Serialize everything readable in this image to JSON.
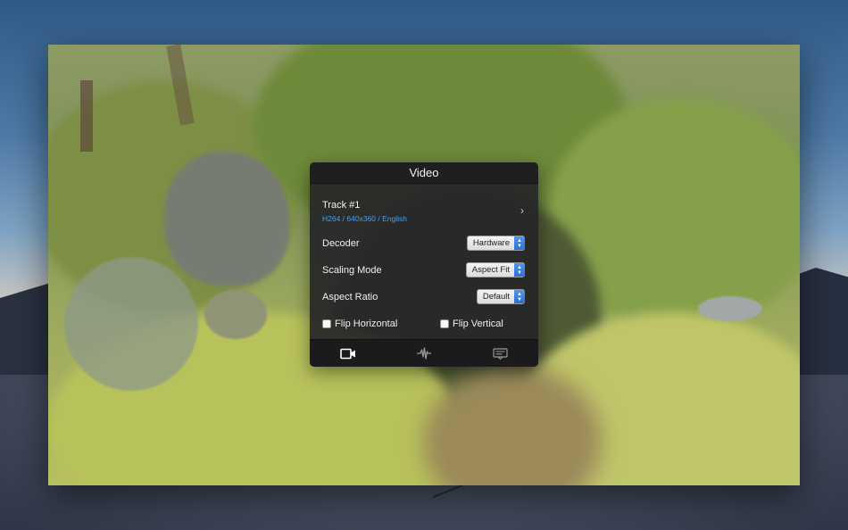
{
  "panel": {
    "title": "Video",
    "track": {
      "title": "Track #1",
      "subtitle": "H264 / 640x360 / English",
      "chevron": "›"
    },
    "settings": [
      {
        "label": "Decoder",
        "value": "Hardware"
      },
      {
        "label": "Scaling Mode",
        "value": "Aspect Fit"
      },
      {
        "label": "Aspect Ratio",
        "value": "Default"
      }
    ],
    "flip_horizontal": {
      "label": "Flip Horizontal",
      "checked": false
    },
    "flip_vertical": {
      "label": "Flip Vertical",
      "checked": false
    },
    "tabs": [
      {
        "icon": "video-camera-icon",
        "active": true
      },
      {
        "icon": "audio-waveform-icon",
        "active": false
      },
      {
        "icon": "subtitles-icon",
        "active": false
      }
    ]
  },
  "colors": {
    "accent": "#4a9ef0",
    "panel_bg": "#262628",
    "select_arrow": "#2b6fd6"
  }
}
